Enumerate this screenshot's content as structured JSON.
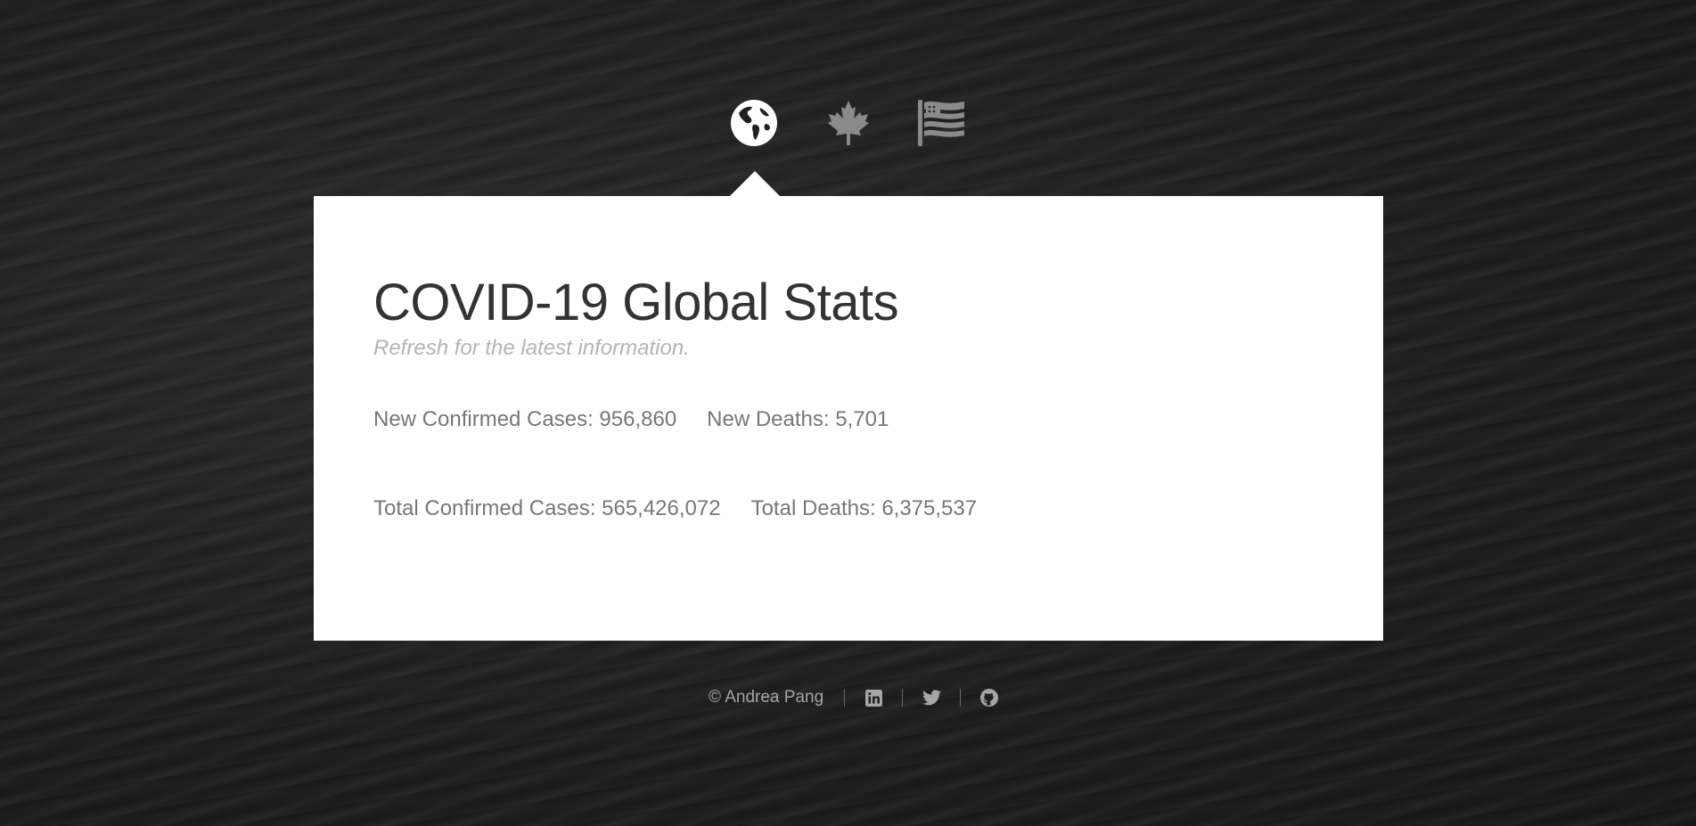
{
  "nav": {
    "items": [
      {
        "icon": "globe-icon",
        "active": true
      },
      {
        "icon": "maple-leaf-icon",
        "active": false
      },
      {
        "icon": "us-flag-icon",
        "active": false
      }
    ]
  },
  "card": {
    "title": "COVID-19 Global Stats",
    "subtitle": "Refresh for the latest information.",
    "new_confirmed": "New Confirmed Cases: 956,860",
    "new_deaths": "New Deaths: 5,701",
    "total_confirmed": "Total Confirmed Cases: 565,426,072",
    "total_deaths": "Total Deaths: 6,375,537"
  },
  "footer": {
    "copyright": "© Andrea Pang",
    "links": [
      {
        "icon": "linkedin-icon"
      },
      {
        "icon": "twitter-icon"
      },
      {
        "icon": "github-icon"
      }
    ]
  },
  "colors": {
    "background": "#202020",
    "card": "#ffffff",
    "active_icon": "#ffffff",
    "inactive_icon": "#8a8a8a"
  }
}
